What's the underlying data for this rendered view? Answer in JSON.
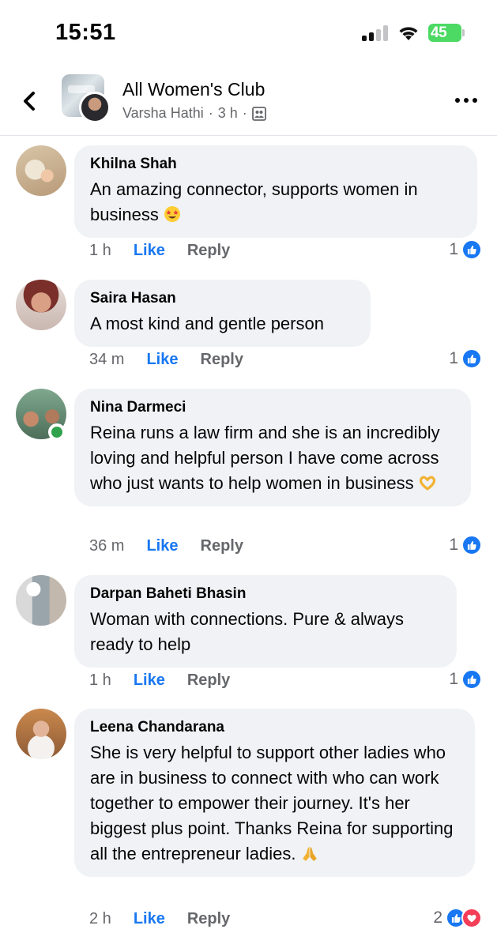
{
  "status_bar": {
    "time": "15:51",
    "battery": "45",
    "battery_color": "#4cd964"
  },
  "header": {
    "title": "All Women's Club",
    "poster": "Varsha Hathi",
    "separator": "·",
    "time": "3 h",
    "separator2": "·",
    "back_icon": "chevron-left-icon",
    "privacy_icon": "group-members-icon",
    "more_icon": "more-dots-icon"
  },
  "colors": {
    "link_blue": "#1877f2",
    "bubble_bg": "#f0f2f5",
    "meta_gray": "#65676b",
    "love_red": "#f33e58",
    "online_green": "#31a24c"
  },
  "comments": [
    {
      "name": "Khilna Shah",
      "text": "An amazing connector, supports women in business",
      "emoji": "star-struck-emoji",
      "time": "1 h",
      "like": "Like",
      "reply": "Reply",
      "reactions": "1",
      "reaction_icons": [
        "like-reaction-icon"
      ]
    },
    {
      "name": "Saira Hasan",
      "text": "A most kind and gentle person",
      "time": "34 m",
      "like": "Like",
      "reply": "Reply",
      "reactions": "1",
      "reaction_icons": [
        "like-reaction-icon"
      ]
    },
    {
      "name": "Nina Darmeci",
      "text": "Reina runs a law firm and she is an incredibly loving and helpful person I have come across who just wants to help women in business",
      "emoji": "heart-hands-emoji",
      "online": true,
      "time": "36 m",
      "like": "Like",
      "reply": "Reply",
      "reactions": "1",
      "reaction_icons": [
        "like-reaction-icon"
      ]
    },
    {
      "name": "Darpan Baheti Bhasin",
      "text": "Woman with connections. Pure & always ready to help",
      "time": "1 h",
      "like": "Like",
      "reply": "Reply",
      "reactions": "1",
      "reaction_icons": [
        "like-reaction-icon"
      ]
    },
    {
      "name": "Leena Chandarana",
      "text": "She is very helpful to support other ladies who are in business to connect with who can work together to empower their journey. It's her biggest plus point. Thanks Reina for supporting all the entrepreneur ladies.",
      "emoji": "folded-hands-emoji",
      "time": "2 h",
      "like": "Like",
      "reply": "Reply",
      "reactions": "2",
      "reaction_icons": [
        "like-reaction-icon",
        "love-reaction-icon"
      ]
    }
  ]
}
